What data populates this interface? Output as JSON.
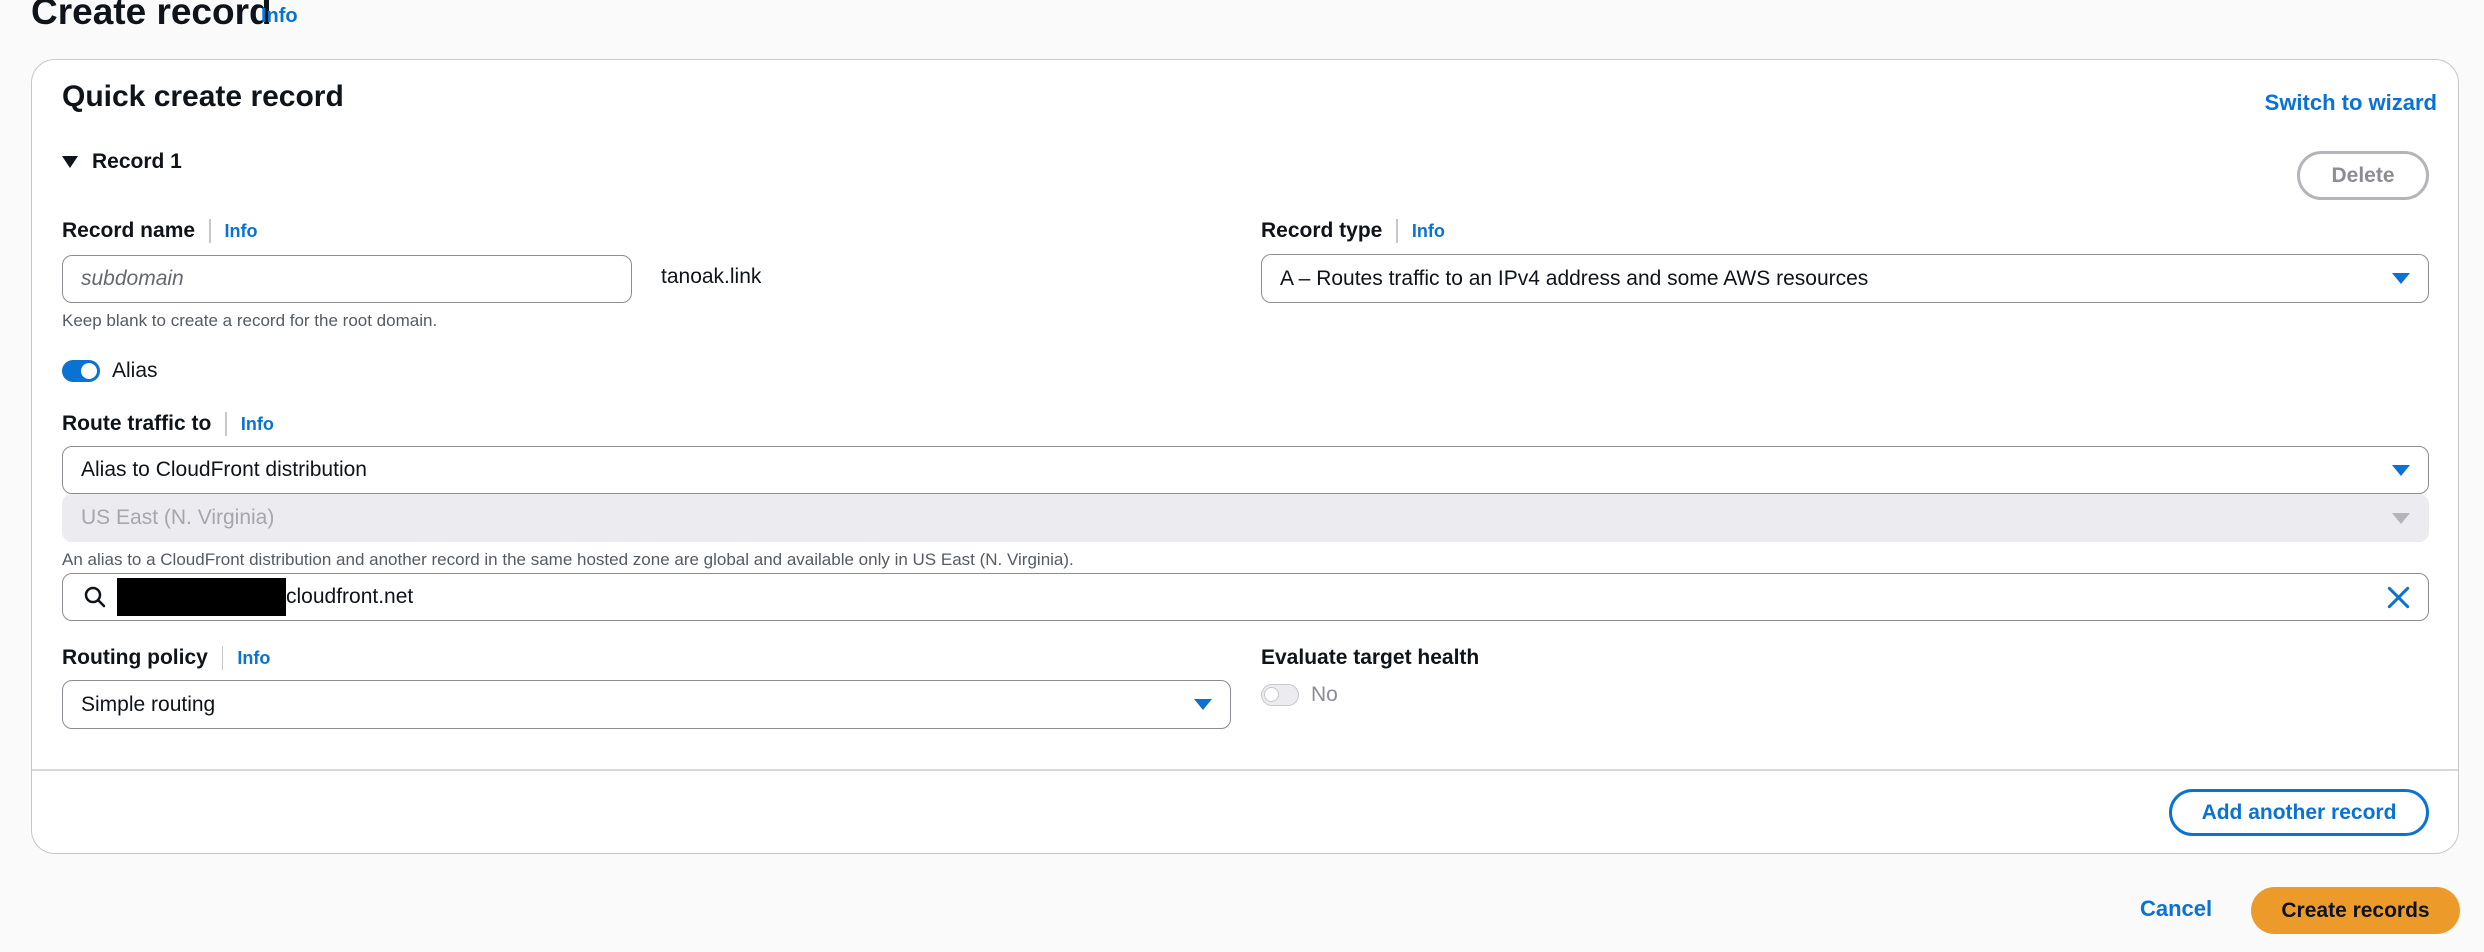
{
  "header": {
    "title": "Create record",
    "info": "Info"
  },
  "card": {
    "title": "Quick create record",
    "switch_link": "Switch to wizard"
  },
  "record": {
    "expander_label": "Record 1",
    "delete_label": "Delete",
    "record_name": {
      "label": "Record name",
      "info": "Info",
      "placeholder": "subdomain",
      "domain_suffix": "tanoak.link",
      "hint": "Keep blank to create a record for the root domain."
    },
    "record_type": {
      "label": "Record type",
      "info": "Info",
      "value": "A – Routes traffic to an IPv4 address and some AWS resources"
    },
    "alias": {
      "label": "Alias",
      "enabled": true
    },
    "route_traffic": {
      "label": "Route traffic to",
      "info": "Info",
      "endpoint_value": "Alias to CloudFront distribution",
      "region_value": "US East (N. Virginia)",
      "region_hint": "An alias to a CloudFront distribution and another record in the same hosted zone are global and available only in US East (N. Virginia).",
      "target_suffix": "cloudfront.net"
    },
    "routing_policy": {
      "label": "Routing policy",
      "info": "Info",
      "value": "Simple routing"
    },
    "evaluate_health": {
      "label": "Evaluate target health",
      "value_label": "No",
      "enabled": false
    }
  },
  "footer": {
    "add_another": "Add another record",
    "cancel": "Cancel",
    "create": "Create records"
  },
  "colors": {
    "accent": "#0972d3",
    "primary_button": "#ec9b2a"
  },
  "icons": [
    "chevron-down-icon",
    "search-icon",
    "close-icon",
    "caret-down-icon"
  ]
}
